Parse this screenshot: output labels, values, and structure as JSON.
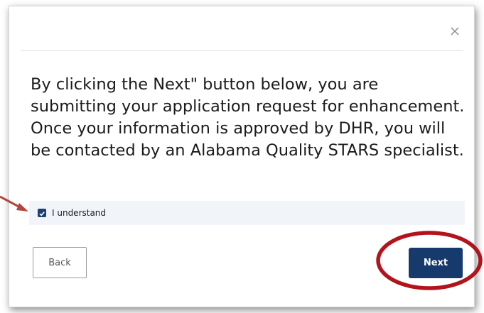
{
  "dialog": {
    "close_icon": "close-icon",
    "message": "By clicking the Next\" button below, you are submitting your application request for enhancement. Once your information is approved by DHR, you will be contacted by an Alabama Quality STARS specialist.",
    "acknowledgement": {
      "label": "I understand",
      "checked": true
    },
    "back_label": "Back",
    "next_label": "Next"
  },
  "annotations": {
    "arrow_color": "#b5463d",
    "highlight_color": "#b3141c"
  },
  "colors": {
    "primary": "#163a6c",
    "ack_background": "#f1f4f9"
  }
}
